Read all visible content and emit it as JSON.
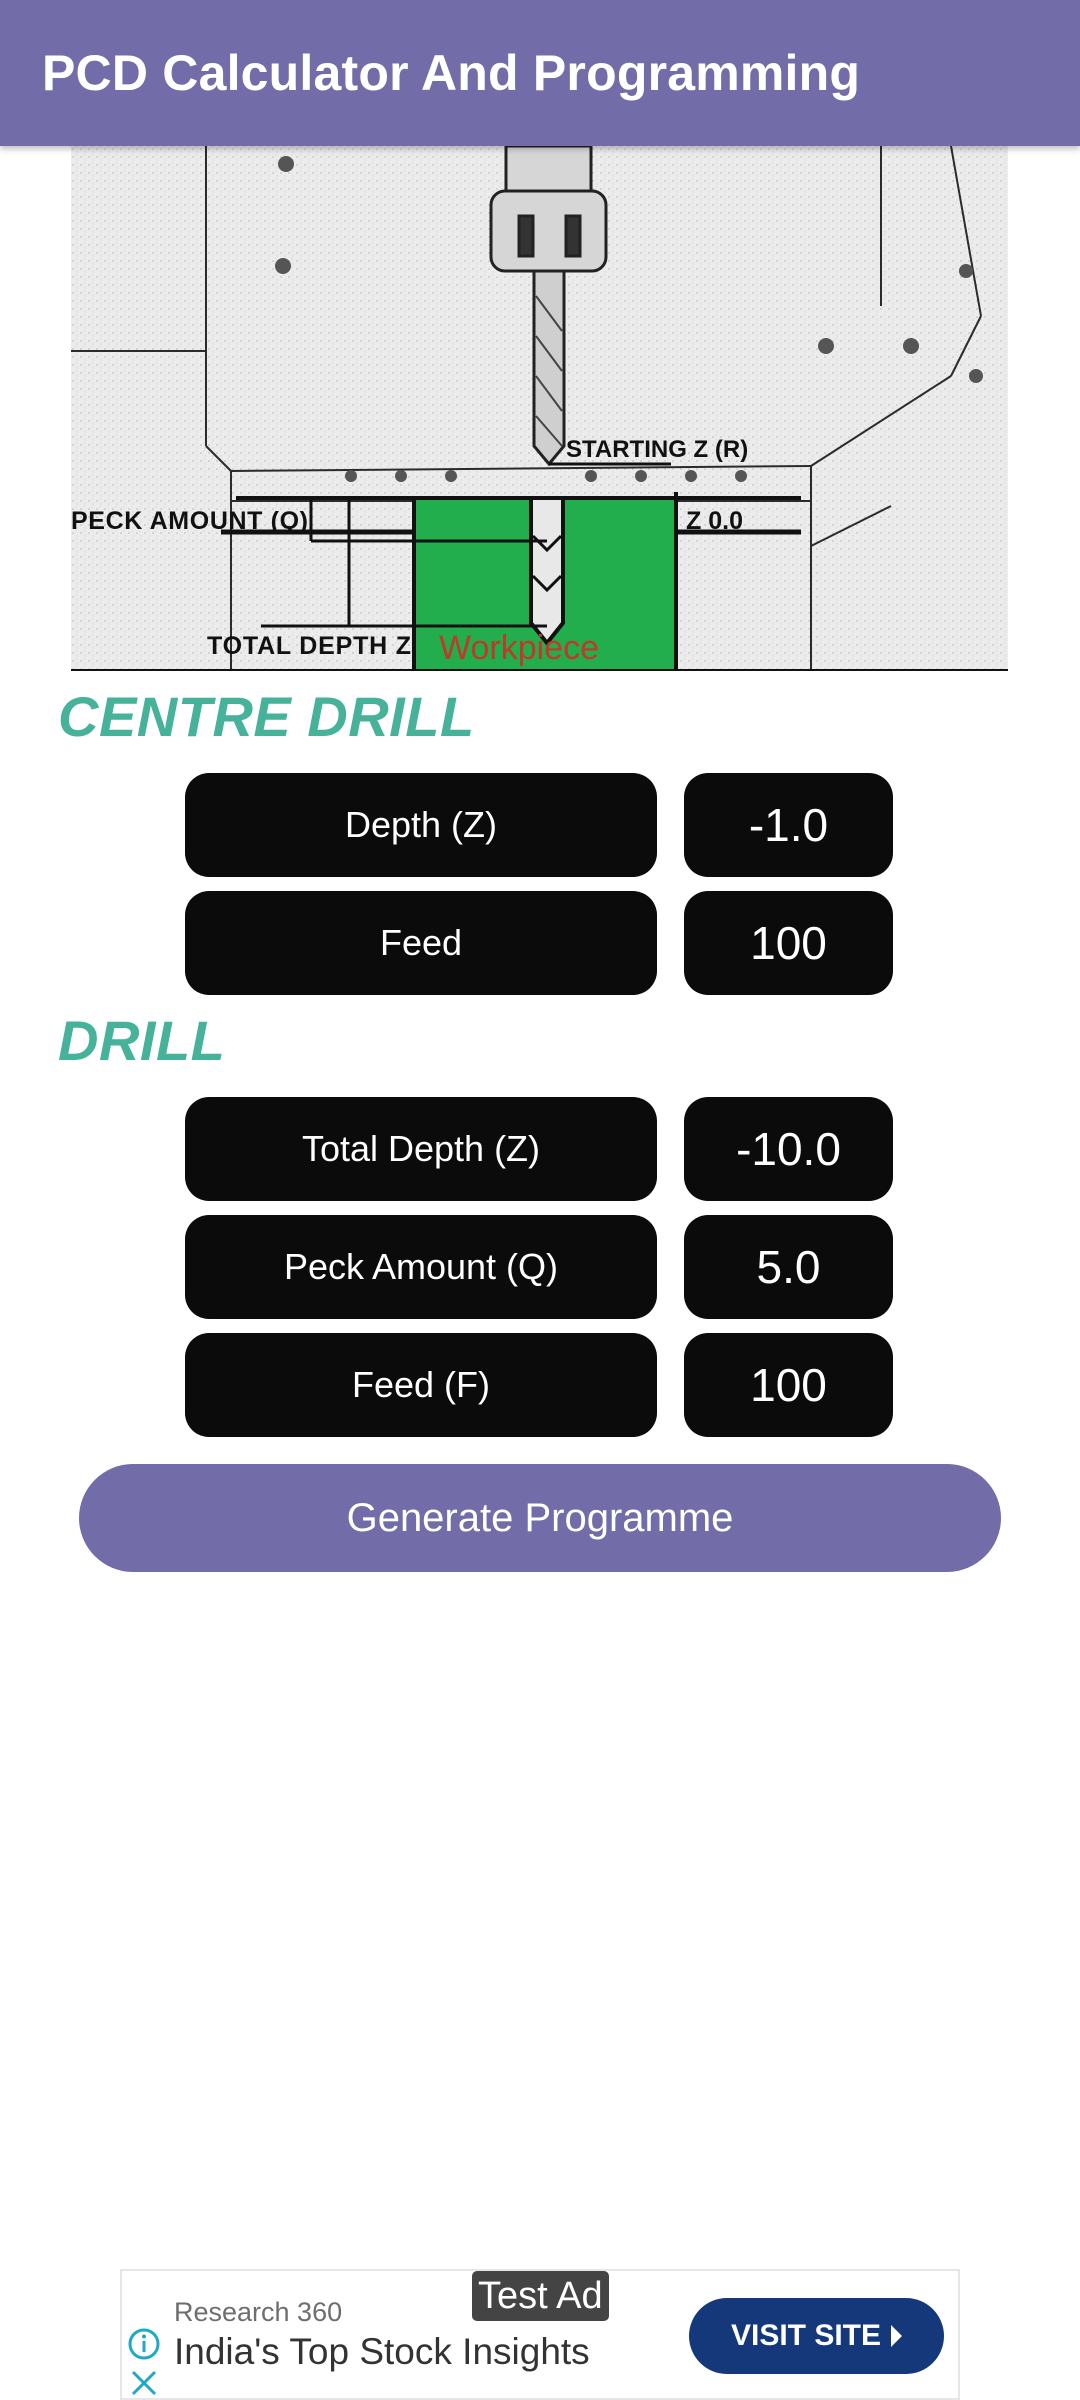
{
  "app_bar": {
    "title": "PCD Calculator And Programming",
    "color": "#726ca9"
  },
  "diagram": {
    "labels": {
      "starting_z": "STARTING Z (R)",
      "peck_amount": "PECK AMOUNT (Q)",
      "z_zero": "Z 0.0",
      "total_depth": "TOTAL DEPTH Z",
      "workpiece": "Workpiece"
    },
    "colors": {
      "workpiece": "#22ae4c",
      "workpiece_label": "#c0392b"
    }
  },
  "sections": {
    "centre_drill": {
      "heading": "CENTRE DRILL",
      "fields": [
        {
          "label": "Depth (Z)",
          "value": "-1.0"
        },
        {
          "label": "Feed",
          "value": "100"
        }
      ]
    },
    "drill": {
      "heading": "DRILL",
      "fields": [
        {
          "label": "Total Depth (Z)",
          "value": "-10.0"
        },
        {
          "label": "Peck Amount (Q)",
          "value": "5.0"
        },
        {
          "label": "Feed (F)",
          "value": "100"
        }
      ]
    },
    "heading_color": "#46b29a"
  },
  "actions": {
    "generate_label": "Generate Programme"
  },
  "ad": {
    "badge": "Test Ad",
    "advertiser": "Research 360",
    "headline": "India's Top Stock Insights",
    "cta_label": "VISIT SITE",
    "cta_color": "#14387a",
    "icon_color": "#1fa9c6"
  }
}
